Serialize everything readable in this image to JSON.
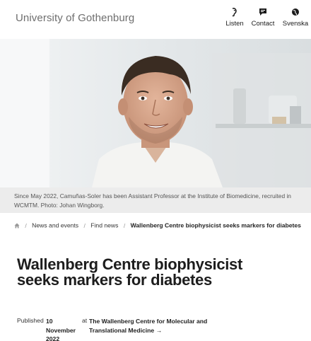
{
  "header": {
    "logo_text": "University of Gothenburg",
    "nav": [
      {
        "label": "Listen",
        "icon": "listen-icon"
      },
      {
        "label": "Contact",
        "icon": "chat-icon"
      },
      {
        "label": "Svenska",
        "icon": "globe-icon"
      }
    ]
  },
  "hero": {
    "caption": "Since May 2022, Camuñas-Soler has been Assistant Professor at the Institute of Biomedicine, recruited in WCMTM. Photo: Johan Wingborg."
  },
  "breadcrumb": {
    "home_icon": "home-icon",
    "items": [
      "News and events",
      "Find news"
    ],
    "current": "Wallenberg Centre biophysicist seeks markers for diabetes"
  },
  "article": {
    "title": "Wallenberg Centre biophysicist seeks markers for diabetes",
    "published_label": "Published",
    "published_date": "10 November 2022",
    "at_label": "at",
    "organisation": "The Wallenberg Centre for Molecular and Translational Medicine",
    "organisation_arrow": "→"
  }
}
